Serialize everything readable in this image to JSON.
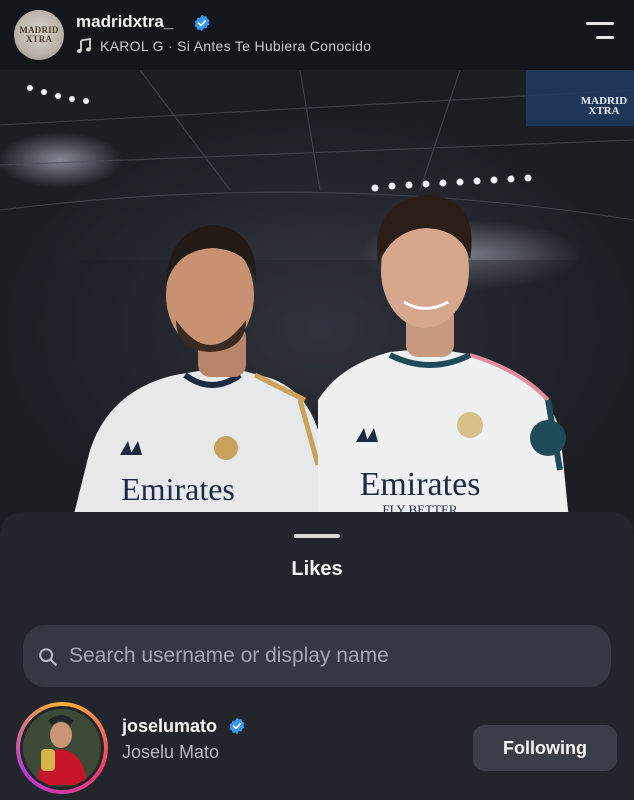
{
  "header": {
    "avatar_logo_text": "MADRID XTRA",
    "username": "madridxtra_",
    "music": "KAROL G · Si Antes Te Hubiera Conocido"
  },
  "post": {
    "watermark": "MADRID XTRA",
    "jersey_sponsor": "Emirates",
    "jersey_slogan": "FLY BETTER"
  },
  "likes_sheet": {
    "title": "Likes",
    "search_placeholder": "Search username or display name",
    "users": [
      {
        "username": "joselumato",
        "display_name": "Joselu Mato",
        "button_label": "Following",
        "verified": true
      }
    ]
  },
  "colors": {
    "verified_blue": "#3897f0",
    "sheet_bg": "#22262c",
    "header_bg": "#13161b"
  }
}
